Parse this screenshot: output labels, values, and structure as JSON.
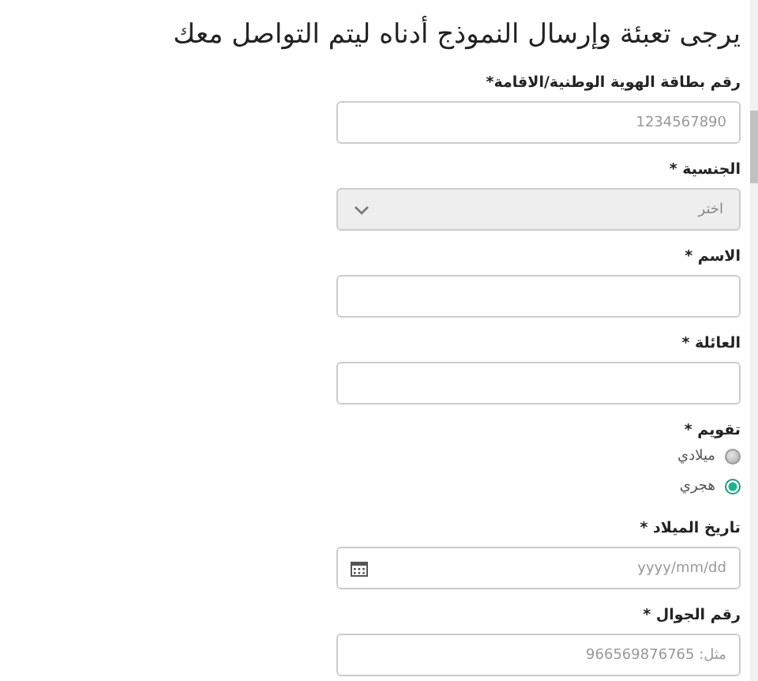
{
  "title": "يرجى تعبئة وإرسال النموذج أدناه ليتم التواصل معك",
  "fields": [
    {
      "kind": "text",
      "label": "رقم بطاقة الهوية الوطنية/الاقامة*",
      "placeholder": "1234567890"
    },
    {
      "kind": "select",
      "label": "الجنسية *",
      "value": "اختر"
    },
    {
      "kind": "text",
      "label": "الاسم *"
    },
    {
      "kind": "text",
      "label": "العائلة *"
    },
    {
      "kind": "radio",
      "label": "تقويم *",
      "options": [
        {
          "label": "ميلادي",
          "selected": false
        },
        {
          "label": "هجري",
          "selected": true
        }
      ]
    },
    {
      "kind": "date",
      "label": "تاريخ الميلاد *",
      "placeholder": "yyyy/mm/dd"
    },
    {
      "kind": "text",
      "label": "رقم الجوال *",
      "placeholder": "مثل: 966569876765"
    }
  ]
}
